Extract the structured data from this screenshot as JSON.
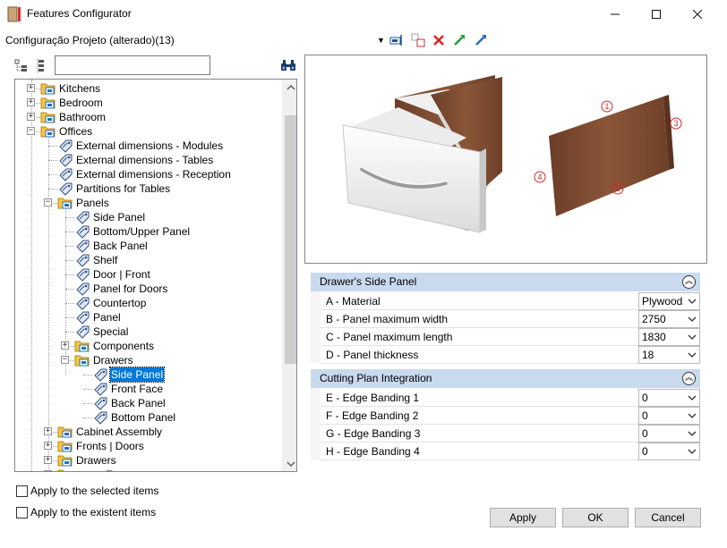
{
  "window": {
    "title": "Features Configurator"
  },
  "config": {
    "name": "Configuração Projeto (alterado)(13)"
  },
  "search": {
    "value": "",
    "placeholder": ""
  },
  "tree": {
    "nodes": [
      {
        "label": "Kitchens"
      },
      {
        "label": "Bedroom"
      },
      {
        "label": "Bathroom"
      },
      {
        "label": "Offices"
      },
      {
        "label": "External dimensions - Modules"
      },
      {
        "label": "External dimensions - Tables"
      },
      {
        "label": "External dimensions - Reception"
      },
      {
        "label": "Partitions for Tables"
      },
      {
        "label": "Panels"
      },
      {
        "label": "Side Panel"
      },
      {
        "label": "Bottom/Upper Panel"
      },
      {
        "label": "Back Panel"
      },
      {
        "label": "Shelf"
      },
      {
        "label": "Door | Front"
      },
      {
        "label": "Panel for Doors"
      },
      {
        "label": "Countertop"
      },
      {
        "label": "Panel"
      },
      {
        "label": "Special"
      },
      {
        "label": "Components"
      },
      {
        "label": "Drawers"
      },
      {
        "label": "Side Panel"
      },
      {
        "label": "Front Face"
      },
      {
        "label": "Back Panel"
      },
      {
        "label": "Bottom Panel"
      },
      {
        "label": "Cabinet Assembly"
      },
      {
        "label": "Fronts | Doors"
      },
      {
        "label": "Drawers"
      },
      {
        "label": "..........Tr"
      }
    ]
  },
  "options": {
    "apply_selected": "Apply to the selected items",
    "apply_existent": "Apply to the existent items"
  },
  "preview": {
    "markers": [
      "1",
      "2",
      "3",
      "4"
    ]
  },
  "sections": [
    {
      "title": "Drawer's Side Panel",
      "rows": [
        {
          "name": "A - Material",
          "value": "Plywood"
        },
        {
          "name": "B - Panel maximum width",
          "value": "2750"
        },
        {
          "name": "C - Panel maximum length",
          "value": "1830"
        },
        {
          "name": "D - Panel thickness",
          "value": "18"
        }
      ]
    },
    {
      "title": "Cutting Plan Integration",
      "rows": [
        {
          "name": "E - Edge Banding 1",
          "value": "0"
        },
        {
          "name": "F - Edge Banding 2",
          "value": "0"
        },
        {
          "name": "G - Edge Banding 3",
          "value": "0"
        },
        {
          "name": "H - Edge Banding 4",
          "value": "0"
        }
      ]
    }
  ],
  "buttons": {
    "apply": "Apply",
    "ok": "OK",
    "cancel": "Cancel"
  },
  "colors": {
    "selection": "#0078d7",
    "section_header": "#c9d9ee",
    "wood": "#7a4a30",
    "marker": "#d42a2a"
  }
}
